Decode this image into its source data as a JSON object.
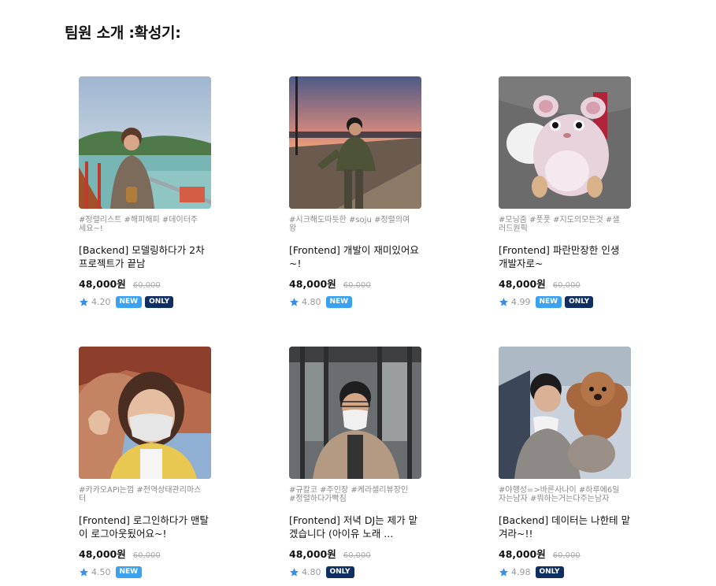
{
  "page": {
    "title": "팀원 소개 :확성기:"
  },
  "colors": {
    "accent_blue": "#3aa2f0",
    "navy": "#0f2f63",
    "star": "#3a8ee8"
  },
  "members": [
    {
      "tags": "#정렬리스트 #해피해피 #데이터주세요~!",
      "name": "[Backend] 모델링하다가 2차 프로젝트가 끝남",
      "price": "48,000원",
      "original_price": "60,000",
      "rating": "4.20",
      "badges": [
        "NEW",
        "ONLY"
      ],
      "photo": "person-at-lake"
    },
    {
      "tags": "#시크해도따듯한 #soju #정렬의여왕",
      "name": "[Frontend] 개발이 재미있어요~!",
      "price": "48,000원",
      "original_price": "60,000",
      "rating": "4.80",
      "badges": [
        "NEW"
      ],
      "photo": "person-at-sunset-beach"
    },
    {
      "tags": "#모닝줌 #풋풋 #지도의모든것 #샐러드원픽",
      "name": "[Frontend] 파란만장한 인생 개발자로~",
      "price": "48,000원",
      "original_price": "60,000",
      "rating": "4.99",
      "badges": [
        "NEW",
        "ONLY"
      ],
      "photo": "hamster-plush"
    },
    {
      "tags": "#카카오API는껌 #전역상태관리마스터",
      "name": "[Frontend] 로그인하다가 맨탈이 로그아웃됬어요~!",
      "price": "48,000원",
      "original_price": "60,000",
      "rating": "4.50",
      "badges": [
        "NEW"
      ],
      "photo": "person-with-mask-autumn"
    },
    {
      "tags": "#규칼코 #주인장 #케라셀리뷰장인 #정렬하다가빡침",
      "name": "[Frontend] 저녁 DJ는 제가 맡겠습니다 (아이유 노래 ...",
      "price": "48,000원",
      "original_price": "60,000",
      "rating": "4.80",
      "badges": [
        "ONLY"
      ],
      "photo": "person-at-bus-stop"
    },
    {
      "tags": "#야행성=>바른사나이 #하루에6일자는남자 #뭐하는거는다주는남자",
      "name": "[Backend] 데이터는 나한테 맡겨라~!!",
      "price": "48,000원",
      "original_price": "60,000",
      "rating": "4.98",
      "badges": [
        "ONLY"
      ],
      "photo": "person-with-dog"
    }
  ]
}
